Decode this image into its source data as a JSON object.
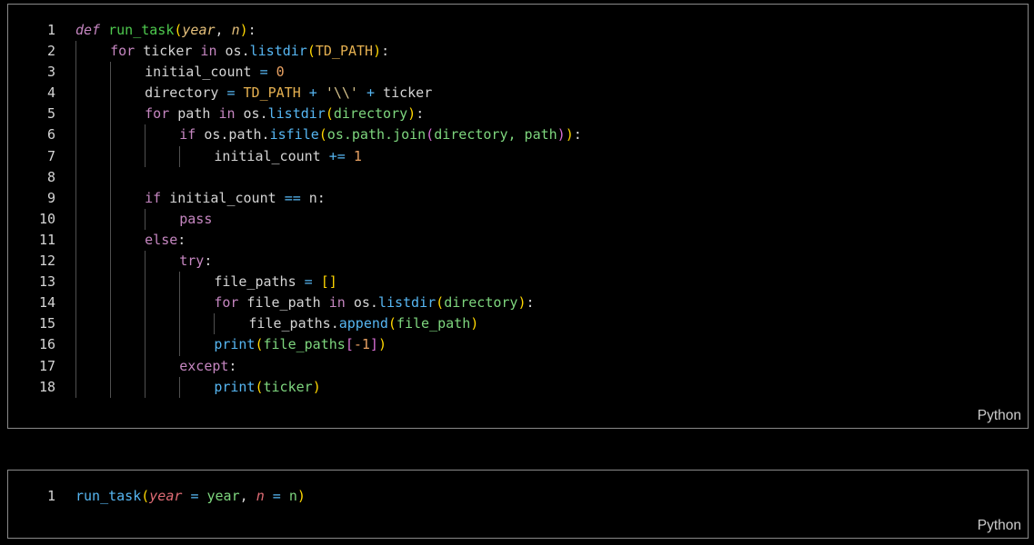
{
  "cells": [
    {
      "language": "Python",
      "lines": [
        {
          "n": "1",
          "indent": 0,
          "tokens": [
            [
              "kwi",
              "def"
            ],
            [
              "id",
              " "
            ],
            [
              "fn",
              "run_task"
            ],
            [
              "b1",
              "("
            ],
            [
              "pa",
              "year"
            ],
            [
              "id",
              ", "
            ],
            [
              "pa",
              "n"
            ],
            [
              "b1",
              ")"
            ],
            [
              "id",
              ":"
            ]
          ]
        },
        {
          "n": "2",
          "indent": 1,
          "tokens": [
            [
              "kw",
              "for"
            ],
            [
              "id",
              " ticker "
            ],
            [
              "kw",
              "in"
            ],
            [
              "id",
              " os."
            ],
            [
              "fnc",
              "listdir"
            ],
            [
              "b1",
              "("
            ],
            [
              "const",
              "TD_PATH"
            ],
            [
              "b1",
              ")"
            ],
            [
              "id",
              ":"
            ]
          ]
        },
        {
          "n": "3",
          "indent": 2,
          "tokens": [
            [
              "id",
              "initial_count "
            ],
            [
              "op",
              "="
            ],
            [
              "id",
              " "
            ],
            [
              "num",
              "0"
            ]
          ]
        },
        {
          "n": "4",
          "indent": 2,
          "tokens": [
            [
              "id",
              "directory "
            ],
            [
              "op",
              "="
            ],
            [
              "id",
              " "
            ],
            [
              "const",
              "TD_PATH"
            ],
            [
              "id",
              " "
            ],
            [
              "op",
              "+"
            ],
            [
              "id",
              " "
            ],
            [
              "str",
              "'\\\\'"
            ],
            [
              "id",
              " "
            ],
            [
              "op",
              "+"
            ],
            [
              "id",
              " ticker"
            ]
          ]
        },
        {
          "n": "5",
          "indent": 2,
          "tokens": [
            [
              "kw",
              "for"
            ],
            [
              "id",
              " path "
            ],
            [
              "kw",
              "in"
            ],
            [
              "id",
              " os."
            ],
            [
              "fnc",
              "listdir"
            ],
            [
              "b1",
              "("
            ],
            [
              "var2",
              "directory"
            ],
            [
              "b1",
              ")"
            ],
            [
              "id",
              ":"
            ]
          ]
        },
        {
          "n": "6",
          "indent": 3,
          "tokens": [
            [
              "kw",
              "if"
            ],
            [
              "id",
              " os.path."
            ],
            [
              "fnc",
              "isfile"
            ],
            [
              "b1",
              "("
            ],
            [
              "var2",
              "os.path.join"
            ],
            [
              "b2",
              "("
            ],
            [
              "var2",
              "directory, path"
            ],
            [
              "b2",
              ")"
            ],
            [
              "b1",
              ")"
            ],
            [
              "id",
              ":"
            ]
          ]
        },
        {
          "n": "7",
          "indent": 4,
          "tokens": [
            [
              "id",
              "initial_count "
            ],
            [
              "op",
              "+="
            ],
            [
              "id",
              " "
            ],
            [
              "num",
              "1"
            ]
          ]
        },
        {
          "n": "8",
          "indent": 0,
          "tokens": []
        },
        {
          "n": "9",
          "indent": 2,
          "tokens": [
            [
              "kw",
              "if"
            ],
            [
              "id",
              " initial_count "
            ],
            [
              "op",
              "=="
            ],
            [
              "id",
              " n:"
            ]
          ]
        },
        {
          "n": "10",
          "indent": 3,
          "tokens": [
            [
              "kw",
              "pass"
            ]
          ]
        },
        {
          "n": "11",
          "indent": 2,
          "tokens": [
            [
              "kw",
              "else"
            ],
            [
              "id",
              ":"
            ]
          ]
        },
        {
          "n": "12",
          "indent": 3,
          "tokens": [
            [
              "kw",
              "try"
            ],
            [
              "id",
              ":"
            ]
          ]
        },
        {
          "n": "13",
          "indent": 4,
          "tokens": [
            [
              "id",
              "file_paths "
            ],
            [
              "op",
              "="
            ],
            [
              "id",
              " "
            ],
            [
              "b1",
              "[]"
            ]
          ]
        },
        {
          "n": "14",
          "indent": 4,
          "tokens": [
            [
              "kw",
              "for"
            ],
            [
              "id",
              " file_path "
            ],
            [
              "kw",
              "in"
            ],
            [
              "id",
              " os."
            ],
            [
              "fnc",
              "listdir"
            ],
            [
              "b1",
              "("
            ],
            [
              "var2",
              "directory"
            ],
            [
              "b1",
              ")"
            ],
            [
              "id",
              ":"
            ]
          ]
        },
        {
          "n": "15",
          "indent": 5,
          "tokens": [
            [
              "id",
              "file_paths."
            ],
            [
              "fnc",
              "append"
            ],
            [
              "b1",
              "("
            ],
            [
              "var2",
              "file_path"
            ],
            [
              "b1",
              ")"
            ]
          ]
        },
        {
          "n": "16",
          "indent": 4,
          "tokens": [
            [
              "fnc",
              "print"
            ],
            [
              "b1",
              "("
            ],
            [
              "var2",
              "file_paths"
            ],
            [
              "b2",
              "["
            ],
            [
              "num",
              "-1"
            ],
            [
              "b2",
              "]"
            ],
            [
              "b1",
              ")"
            ]
          ]
        },
        {
          "n": "17",
          "indent": 3,
          "tokens": [
            [
              "kw",
              "except"
            ],
            [
              "id",
              ":"
            ]
          ]
        },
        {
          "n": "18",
          "indent": 4,
          "tokens": [
            [
              "fnc",
              "print"
            ],
            [
              "b1",
              "("
            ],
            [
              "var2",
              "ticker"
            ],
            [
              "b1",
              ")"
            ]
          ]
        }
      ]
    },
    {
      "language": "Python",
      "lines": [
        {
          "n": "1",
          "indent": 0,
          "tokens": [
            [
              "fnc",
              "run_task"
            ],
            [
              "b1",
              "("
            ],
            [
              "pr",
              "year"
            ],
            [
              "id",
              " "
            ],
            [
              "op",
              "="
            ],
            [
              "id",
              " "
            ],
            [
              "var2",
              "year"
            ],
            [
              "id",
              ", "
            ],
            [
              "pr",
              "n"
            ],
            [
              "id",
              " "
            ],
            [
              "op",
              "="
            ],
            [
              "id",
              " "
            ],
            [
              "var2",
              "n"
            ],
            [
              "b1",
              ")"
            ]
          ]
        }
      ]
    }
  ]
}
